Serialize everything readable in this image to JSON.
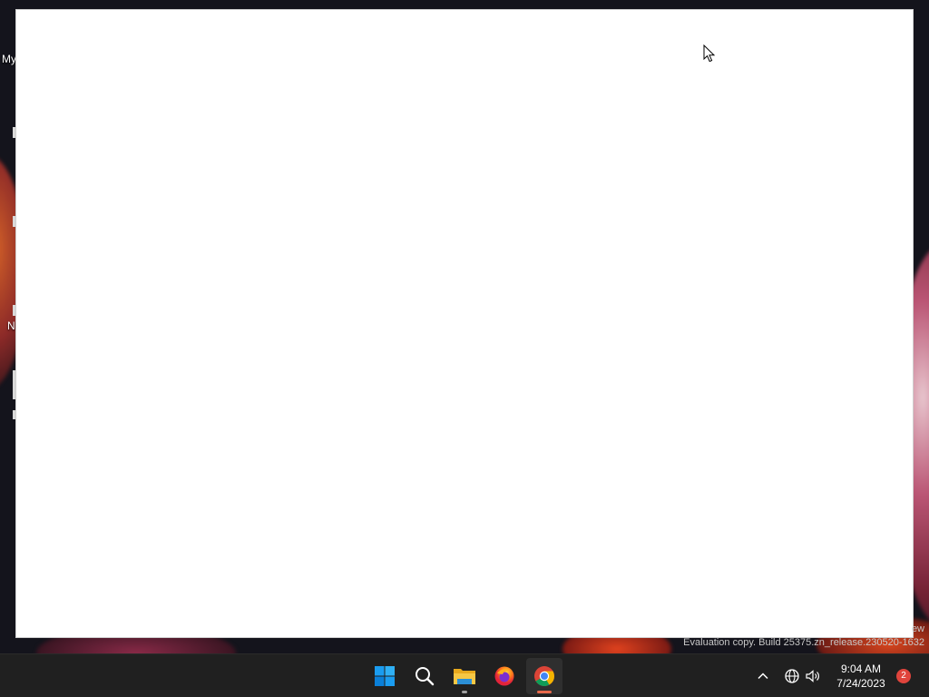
{
  "desktop": {
    "icon_labels": [
      "My",
      "N"
    ]
  },
  "watermark": {
    "line1": "ew",
    "line2": "Evaluation copy. Build 25375.zn_release.230520-1632"
  },
  "taskbar": {
    "apps": [
      {
        "name": "Start",
        "icon": "windows-logo-icon"
      },
      {
        "name": "Search",
        "icon": "search-icon"
      },
      {
        "name": "File Explorer",
        "icon": "folder-icon"
      },
      {
        "name": "Firefox",
        "icon": "firefox-icon"
      },
      {
        "name": "Google Chrome",
        "icon": "chrome-icon",
        "active": true
      }
    ],
    "tray": {
      "icons": [
        "chevron-up-icon",
        "network-icon",
        "volume-icon"
      ],
      "time": "9:04 AM",
      "date": "7/24/2023",
      "notification_count": "2"
    }
  },
  "colors": {
    "taskbar_bg": "#202020",
    "accent": "#0078d4",
    "chrome_indicator": "#e8684a",
    "notif_badge": "#e0443c",
    "window_bg": "#ffffff"
  }
}
